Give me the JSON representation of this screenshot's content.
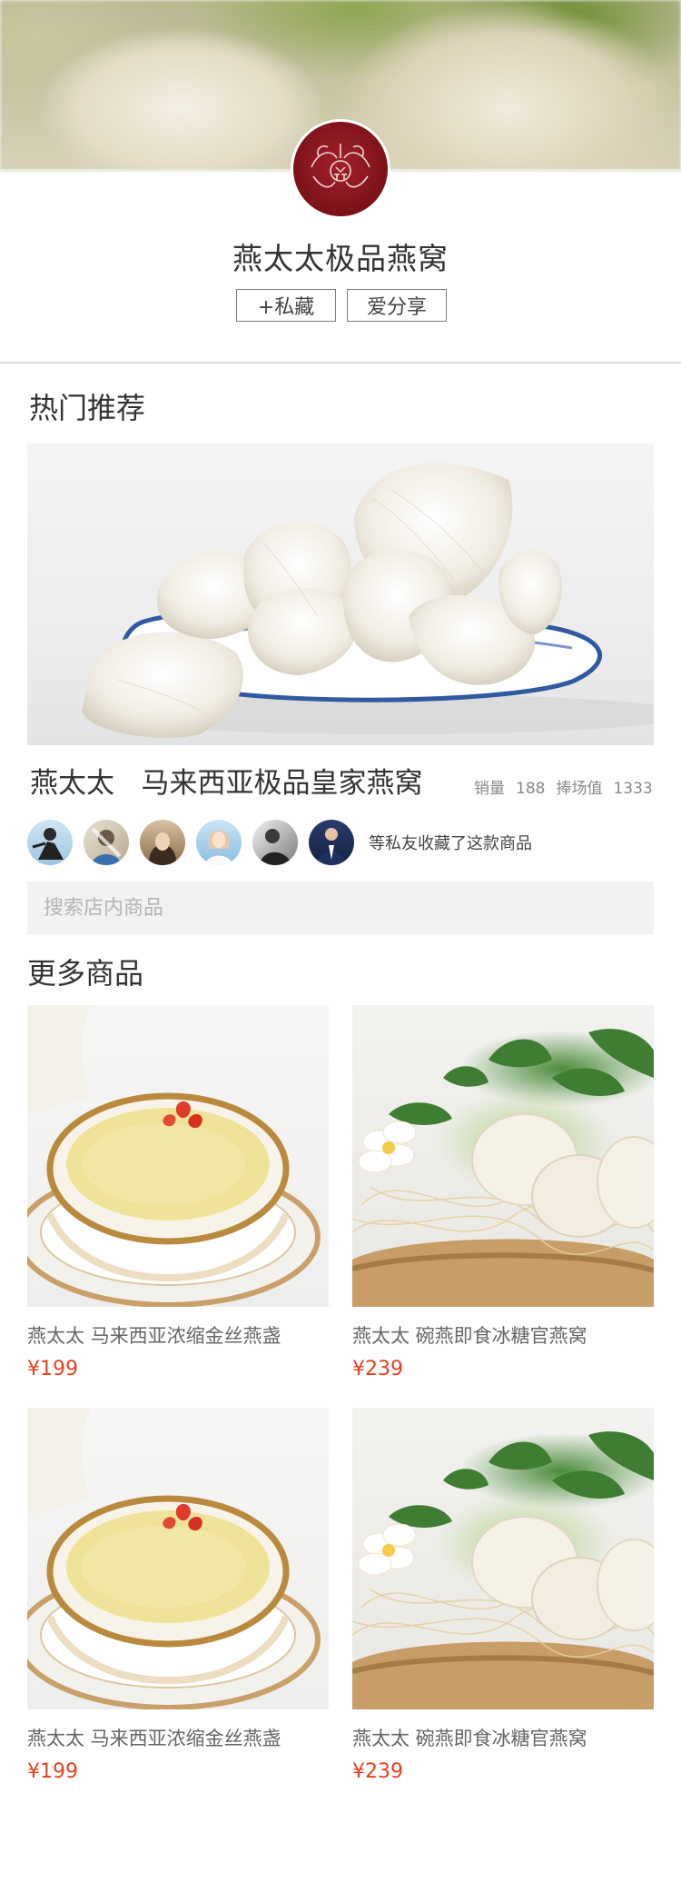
{
  "shop": {
    "name": "燕太太极品燕窝",
    "collect_label": "+私藏",
    "share_label": "爱分享"
  },
  "hot": {
    "section_title": "热门推荐",
    "product_title": "燕太太   马来西亚极品皇家燕窝",
    "sales_label": "销量",
    "sales_value": "188",
    "hype_label": "捧场值",
    "hype_value": "1333",
    "fans_note": "等私友收藏了这款商品",
    "fans_count_shown": 6
  },
  "search": {
    "placeholder": "搜索店内商品"
  },
  "more": {
    "section_title": "更多商品",
    "items": [
      {
        "name": "燕太太 马来西亚浓缩金丝燕盏",
        "price": "¥199",
        "image": "bird-nest-soup-bowl"
      },
      {
        "name": "燕太太 碗燕即食冰糖官燕窝",
        "price": "¥239",
        "image": "bird-nest-on-straw-plate"
      },
      {
        "name": "燕太太 马来西亚浓缩金丝燕盏",
        "price": "¥199",
        "image": "bird-nest-soup-bowl"
      },
      {
        "name": "燕太太 碗燕即食冰糖官燕窝",
        "price": "¥239",
        "image": "bird-nest-on-straw-plate"
      }
    ]
  },
  "colors": {
    "price": "#e8401f",
    "logo_red": "#8a161f",
    "search_bg": "#f2f2f2"
  }
}
